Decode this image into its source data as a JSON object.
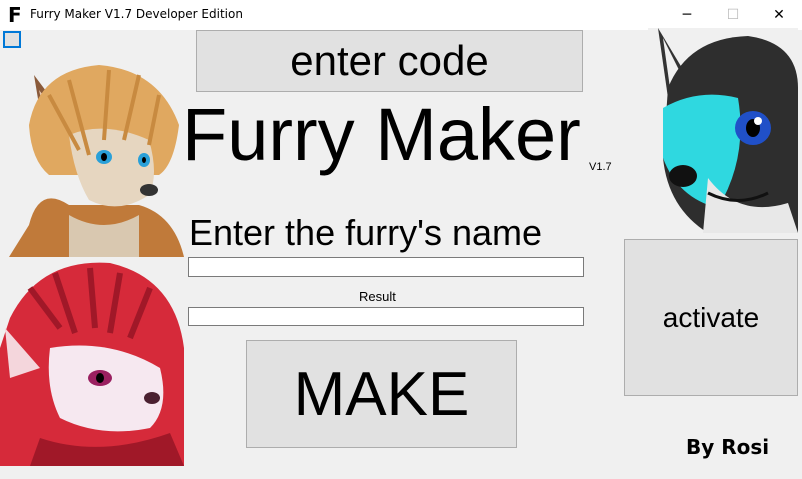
{
  "window": {
    "app_icon_letter": "F",
    "title": "Furry Maker V1.7 Developer Edition",
    "minimize_glyph": "─",
    "maximize_glyph": "☐",
    "close_glyph": "✕"
  },
  "form": {
    "enter_code_label": "enter code",
    "title": "Furry Maker",
    "version": "V1.7",
    "name_prompt": "Enter the furry's name",
    "name_value": "",
    "result_label": "Result",
    "result_value": "",
    "make_label": "MAKE",
    "activate_label": "activate",
    "credit": "By Rosi"
  },
  "images": {
    "portrait_1": "blonde-fox-portrait",
    "portrait_2": "red-wolf-portrait",
    "portrait_3": "cyan-fox-portrait"
  }
}
